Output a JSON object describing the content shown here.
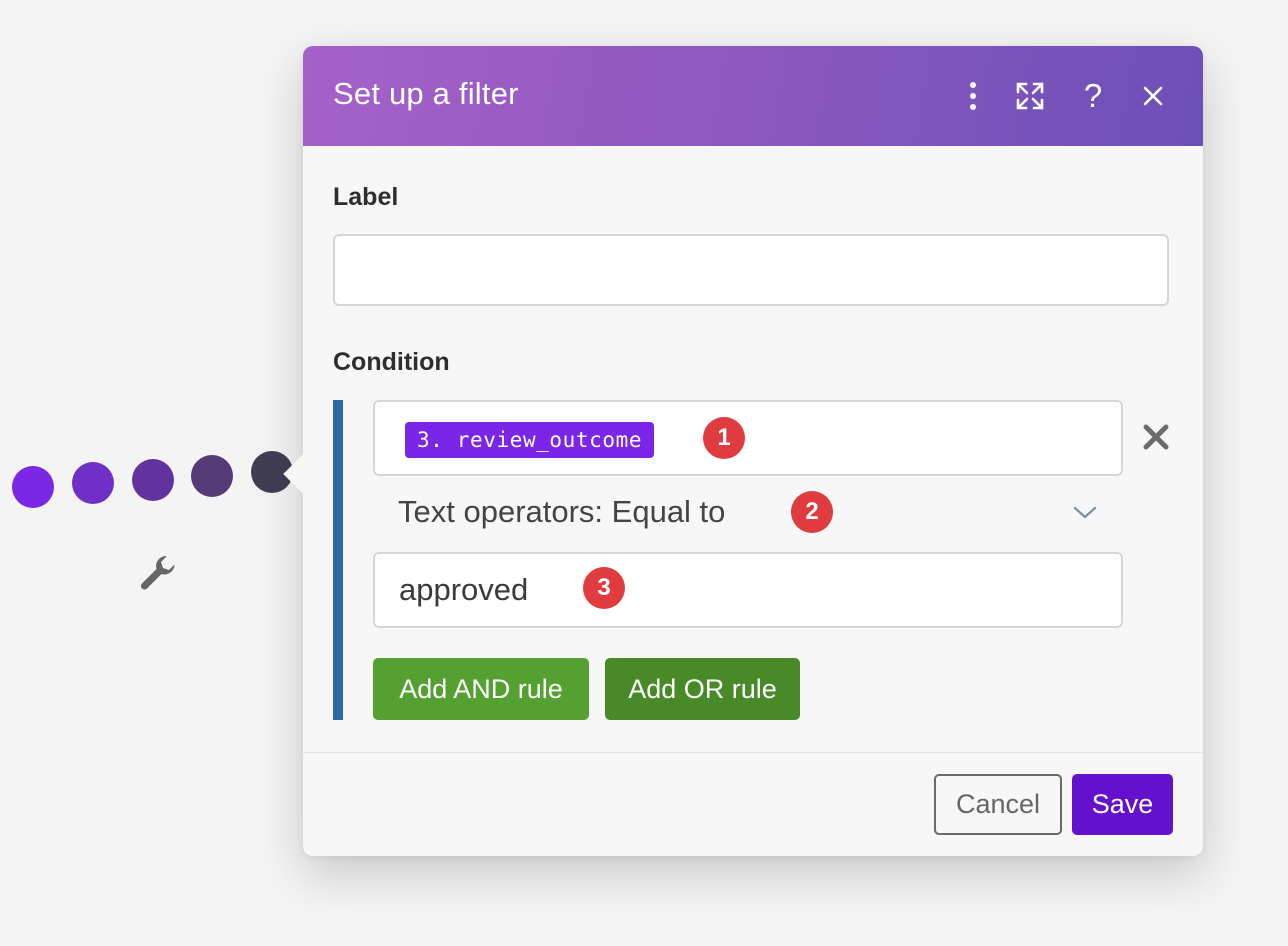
{
  "canvas": {
    "dots": [
      "#7c26e6",
      "#7030c8",
      "#62339f",
      "#553a78",
      "#423d53"
    ],
    "wrench_icon": "wrench-icon"
  },
  "dialog": {
    "title": "Set up a filter",
    "header_icons": [
      "more-vertical-icon",
      "expand-icon",
      "help-icon",
      "close-icon"
    ],
    "help_glyph": "?",
    "header_gradient": [
      "#a661c9",
      "#6c4fb8"
    ]
  },
  "label_section": {
    "heading": "Label",
    "value": "",
    "placeholder": ""
  },
  "condition": {
    "heading": "Condition",
    "field_pill": "3. review_outcome",
    "operator": "Text operators: Equal to",
    "value": "approved",
    "badges": [
      "1",
      "2",
      "3"
    ],
    "add_and_label": "Add AND rule",
    "add_or_label": "Add OR rule",
    "accent": "#2f6aa4"
  },
  "footer": {
    "cancel_label": "Cancel",
    "save_label": "Save",
    "save_color": "#6410cc"
  }
}
